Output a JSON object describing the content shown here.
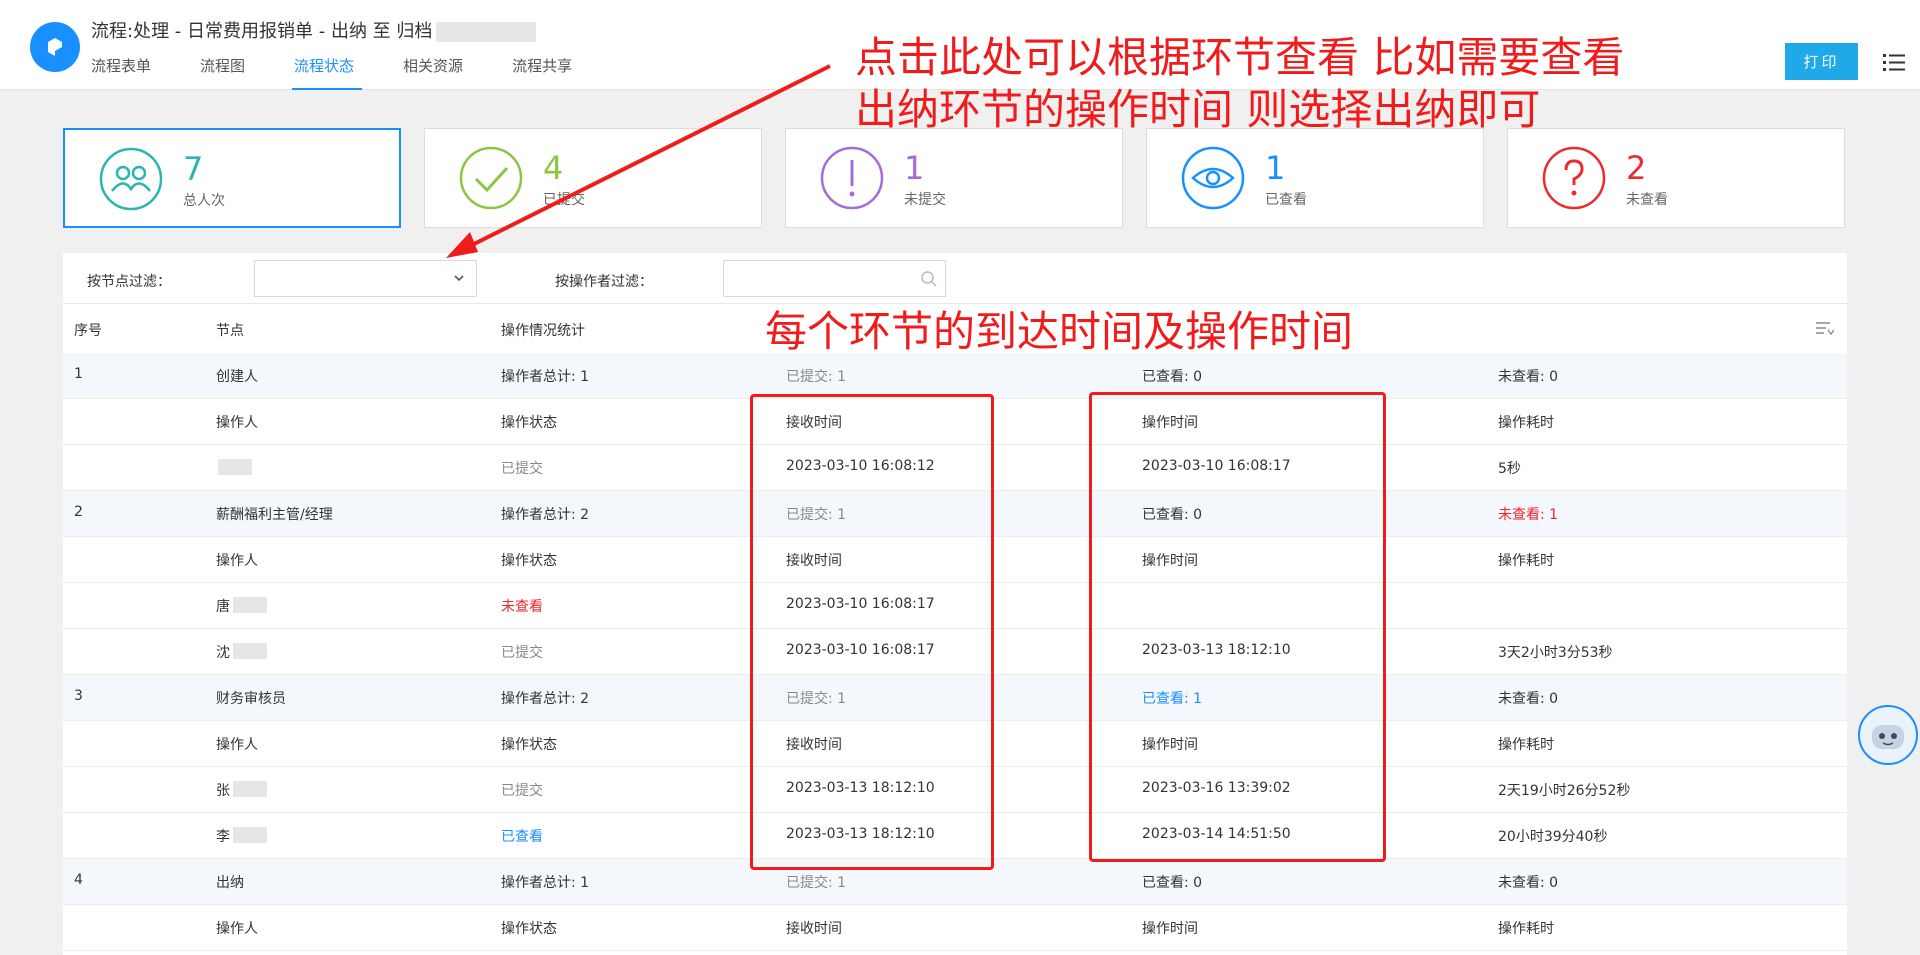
{
  "header": {
    "title": "流程:处理 - 日常费用报销单 - 出纳 至 归档",
    "tabs": [
      {
        "label": "流程表单"
      },
      {
        "label": "流程图"
      },
      {
        "label": "流程状态",
        "active": true
      },
      {
        "label": "相关资源"
      },
      {
        "label": "流程共享"
      }
    ],
    "print_label": "打印"
  },
  "stats": [
    {
      "num": "7",
      "label": "总人次",
      "color": "#2bb5b0",
      "icon": "users-icon"
    },
    {
      "num": "4",
      "label": "已提交",
      "color": "#8cc540",
      "icon": "check-circle-icon"
    },
    {
      "num": "1",
      "label": "未提交",
      "color": "#a56bd6",
      "icon": "exclamation-circle-icon"
    },
    {
      "num": "1",
      "label": "已查看",
      "color": "#1890ff",
      "icon": "eye-icon"
    },
    {
      "num": "2",
      "label": "未查看",
      "color": "#f0292d",
      "icon": "question-circle-icon"
    }
  ],
  "filters": {
    "node_label": "按节点过滤：",
    "operator_label": "按操作者过滤："
  },
  "table": {
    "headers": [
      "序号",
      "节点",
      "操作情况统计"
    ],
    "rows": [
      {
        "type": "group",
        "cells": [
          "1",
          "创建人",
          "操作者总计: 1",
          "已提交: 1",
          "已查看: 0",
          "未查看: 0"
        ]
      },
      {
        "type": "sub",
        "cells": [
          "",
          "操作人",
          "操作状态",
          "接收时间",
          "操作时间",
          "操作耗时"
        ]
      },
      {
        "type": "person",
        "cells": [
          "",
          "",
          "已提交",
          "2023-03-10 16:08:12",
          "2023-03-10 16:08:17",
          "5秒"
        ]
      },
      {
        "type": "group",
        "cells": [
          "2",
          "薪酬福利主管/经理",
          "操作者总计: 2",
          "已提交: 1",
          "已查看: 0",
          "未查看: 1"
        ]
      },
      {
        "type": "sub",
        "cells": [
          "",
          "操作人",
          "操作状态",
          "接收时间",
          "操作时间",
          "操作耗时"
        ]
      },
      {
        "type": "person",
        "cells": [
          "",
          "唐",
          "未查看",
          "2023-03-10 16:08:17",
          "",
          ""
        ]
      },
      {
        "type": "person",
        "cells": [
          "",
          "沈",
          "已提交",
          "2023-03-10 16:08:17",
          "2023-03-13 18:12:10",
          "3天2小时3分53秒"
        ]
      },
      {
        "type": "group",
        "cells": [
          "3",
          "财务审核员",
          "操作者总计: 2",
          "已提交: 1",
          "已查看: 1",
          "未查看: 0"
        ]
      },
      {
        "type": "sub",
        "cells": [
          "",
          "操作人",
          "操作状态",
          "接收时间",
          "操作时间",
          "操作耗时"
        ]
      },
      {
        "type": "person",
        "cells": [
          "",
          "张",
          "已提交",
          "2023-03-13 18:12:10",
          "2023-03-16 13:39:02",
          "2天19小时26分52秒"
        ]
      },
      {
        "type": "person",
        "cells": [
          "",
          "李",
          "已查看",
          "2023-03-13 18:12:10",
          "2023-03-14 14:51:50",
          "20小时39分40秒"
        ]
      },
      {
        "type": "group",
        "cells": [
          "4",
          "出纳",
          "操作者总计: 1",
          "已提交: 1",
          "已查看: 0",
          "未查看: 0"
        ]
      },
      {
        "type": "sub",
        "cells": [
          "",
          "操作人",
          "操作状态",
          "接收时间",
          "操作时间",
          "操作耗时"
        ]
      }
    ]
  },
  "annotations": {
    "top_line1": "点击此处可以根据环节查看 比如需要查看",
    "top_line2": "出纳环节的操作时间 则选择出纳即可",
    "middle": "每个环节的到达时间及操作时间",
    "color": "#f01c1c"
  }
}
